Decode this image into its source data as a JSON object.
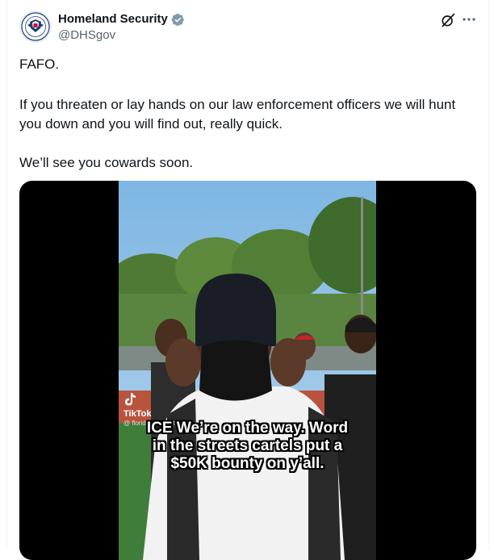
{
  "author": {
    "display_name": "Homeland Security",
    "handle": "@DHSgov"
  },
  "tweet": {
    "paragraph_1": "FAFO.",
    "paragraph_2": "If you threaten or lay hands on our law enforcement officers we will hunt you down and you will find out, really quick.",
    "paragraph_3": "We’ll see you cowards soon."
  },
  "video": {
    "watermark_brand": "TikTok",
    "watermark_user": "@ floridanewsedit",
    "caption_line_1": "ICE We’re on the way. Word",
    "caption_line_2": "in the streets cartels put a",
    "caption_line_3": "$50K bounty on y’all."
  },
  "icons": {
    "verified": "verified-badge-icon",
    "grok": "grok-icon",
    "more": "more-options-icon",
    "tiktok": "tiktok-logo-icon"
  },
  "colors": {
    "text": "#0f1419",
    "secondary": "#536471",
    "verified": "#829aab",
    "media_bg": "#000000"
  }
}
